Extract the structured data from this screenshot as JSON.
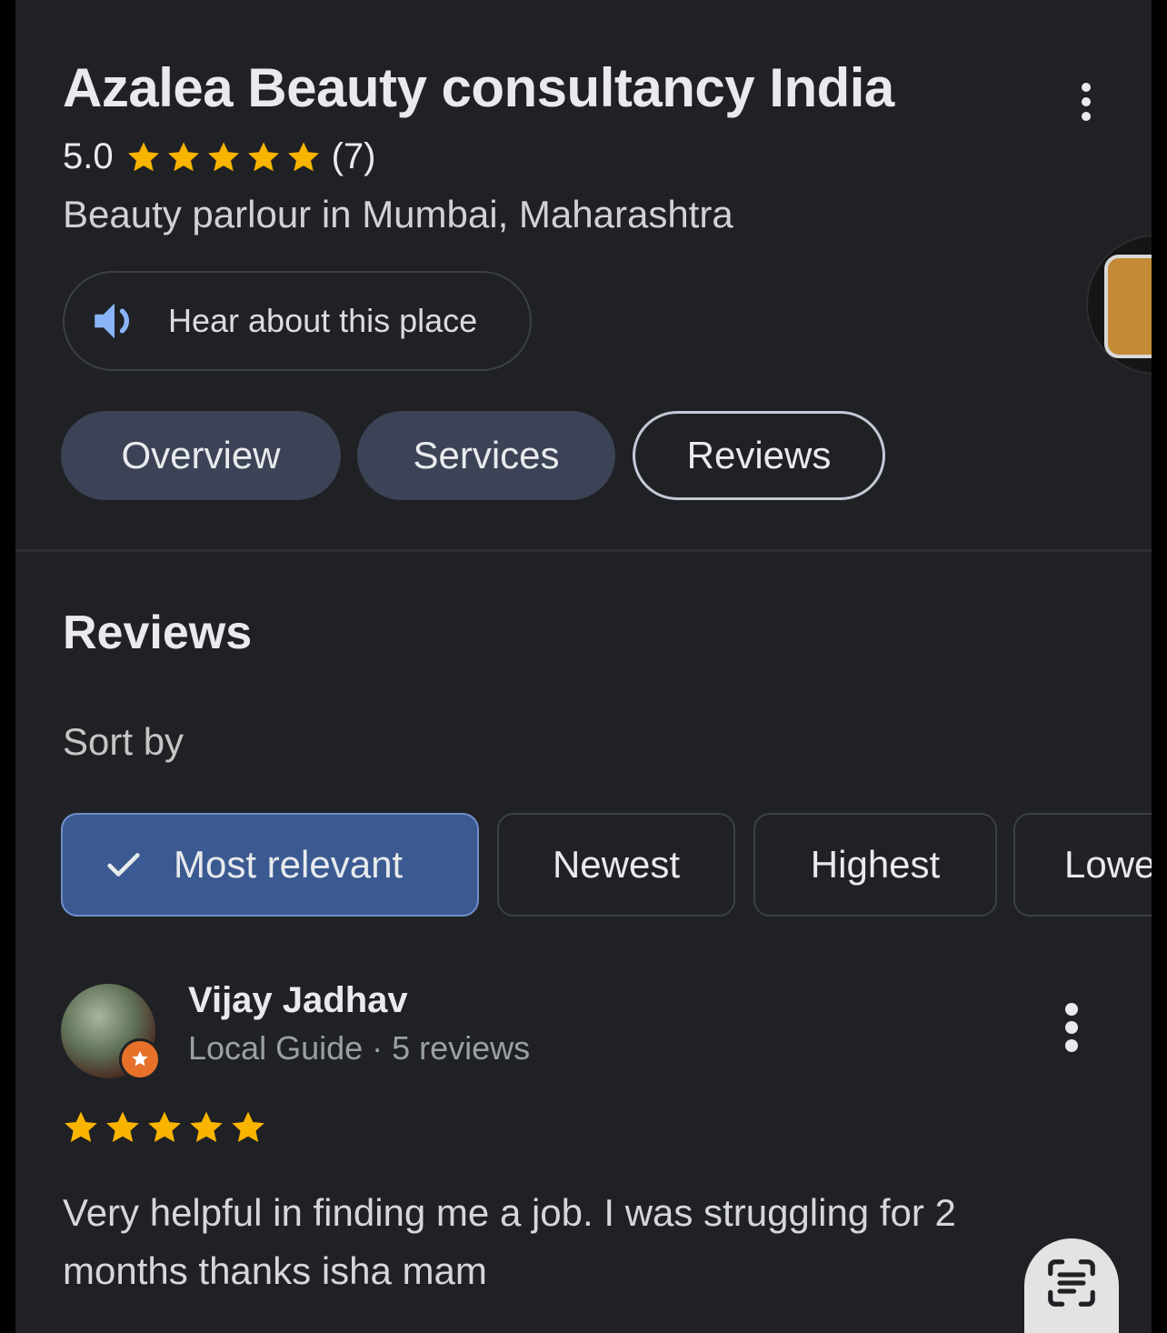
{
  "place": {
    "name": "Azalea Beauty consultancy India",
    "rating": "5.0",
    "rating_stars": 5,
    "review_count": "(7)",
    "category": "Beauty parlour in Mumbai, Maharashtra"
  },
  "hear_button": {
    "label": "Hear about this place",
    "icon": "speaker-icon"
  },
  "tabs": [
    {
      "label": "Overview",
      "active": false
    },
    {
      "label": "Services",
      "active": false
    },
    {
      "label": "Reviews",
      "active": true
    }
  ],
  "reviews_section": {
    "title": "Reviews",
    "sort_label": "Sort by",
    "sort_options": [
      {
        "label": "Most relevant",
        "selected": true
      },
      {
        "label": "Newest",
        "selected": false
      },
      {
        "label": "Highest",
        "selected": false
      },
      {
        "label": "Lowe",
        "selected": false
      }
    ]
  },
  "review": {
    "author": "Vijay Jadhav",
    "meta": "Local Guide · 5 reviews",
    "stars": 5,
    "text": "Very helpful in finding me a job. I was struggling for 2 months thanks isha mam"
  },
  "colors": {
    "background": "#202124",
    "star": "#f9b400",
    "tab_fill": "#3c4356",
    "chip_selected": "#3b5a91",
    "speaker": "#8ab4f8",
    "local_guide_badge": "#e8712a"
  }
}
